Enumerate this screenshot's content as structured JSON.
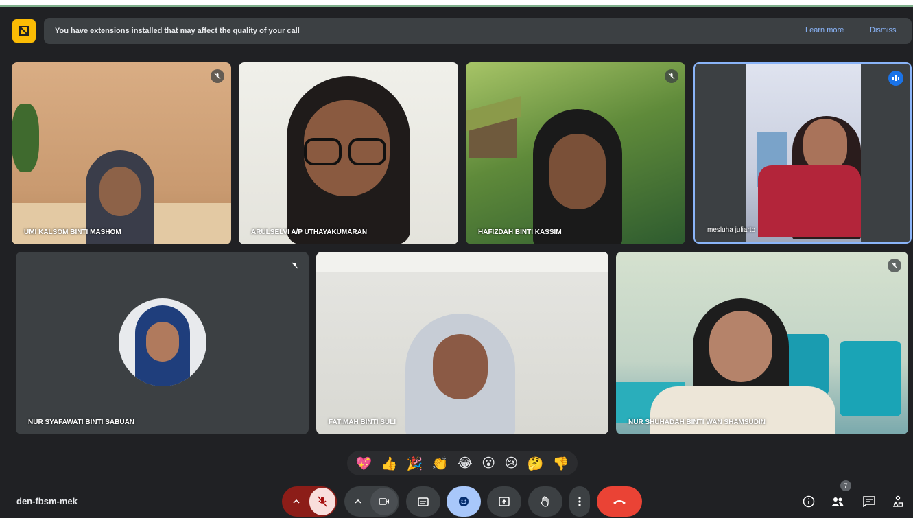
{
  "banner": {
    "message": "You have extensions installed that may affect the quality of your call",
    "learn_more": "Learn more",
    "dismiss": "Dismiss"
  },
  "participants": [
    {
      "name": "UMI KALSOM BINTI MASHOM",
      "muted": true
    },
    {
      "name": "ARULSELVI A/P UTHAYAKUMARAN",
      "muted": false
    },
    {
      "name": "HAFIZDAH BINTI KASSIM",
      "muted": true
    },
    {
      "name": "mesluha juliarto",
      "muted": false,
      "speaking": true
    },
    {
      "name": "NUR SYAFAWATI BINTI SABUAN",
      "muted": true
    },
    {
      "name": "FATIMAH BINTI SULI",
      "muted": false
    },
    {
      "name": "NUR SHUHADAH BINTI WAN SHAMSUDIN",
      "muted": true
    }
  ],
  "reactions": [
    "💖",
    "👍",
    "🎉",
    "👏",
    "😂",
    "😮",
    "😢",
    "🤔",
    "👎"
  ],
  "meeting": {
    "code": "den-fbsm-mek",
    "participant_count": "7"
  },
  "colors": {
    "accent": "#1a73e8",
    "end_call": "#ea4335",
    "banner_icon": "#fbbc04",
    "mic_off": "#a50e0e"
  }
}
